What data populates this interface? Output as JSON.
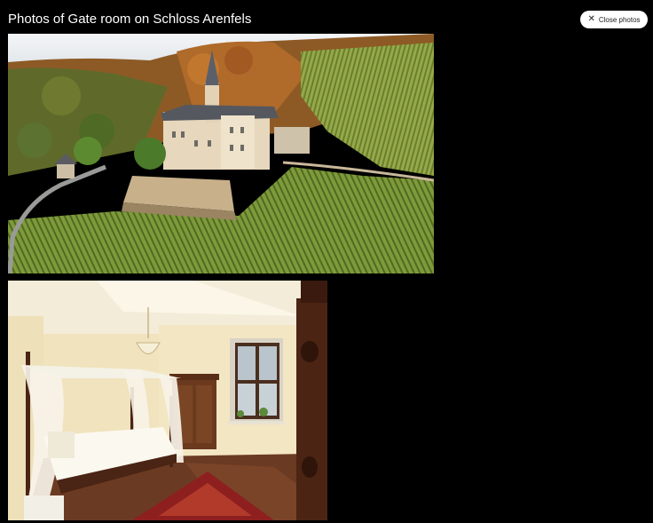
{
  "header": {
    "title": "Photos of Gate room on Schloss Arenfels"
  },
  "close_button": {
    "label": "Close photos",
    "icon": "close-icon"
  },
  "photos": [
    {
      "subject": "castle-vineyard-aerial"
    },
    {
      "subject": "canopy-bedroom"
    }
  ]
}
